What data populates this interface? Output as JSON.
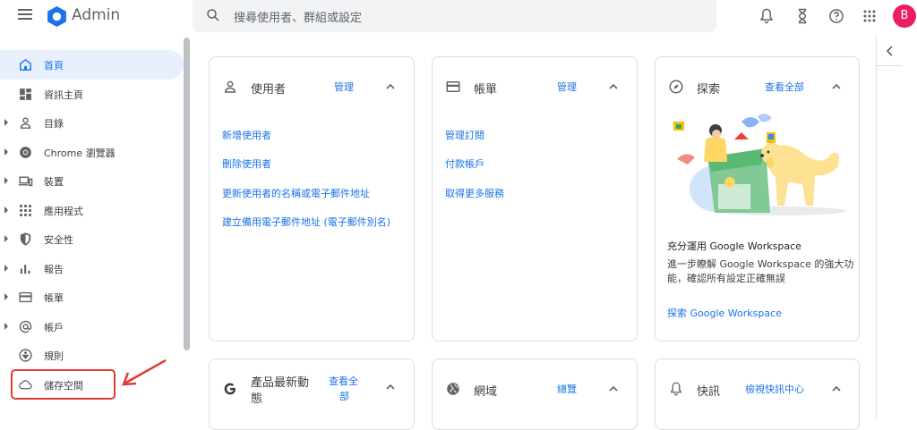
{
  "app": {
    "name": "Admin",
    "avatar_letter": "B"
  },
  "search": {
    "placeholder": "搜尋使用者、群組或設定"
  },
  "sidebar": {
    "items": [
      {
        "label": "首頁",
        "icon": "home-icon",
        "active": true,
        "expandable": false
      },
      {
        "label": "資訊主頁",
        "icon": "dashboard-icon",
        "active": false,
        "expandable": false
      },
      {
        "label": "目錄",
        "icon": "person-icon",
        "active": false,
        "expandable": true
      },
      {
        "label": "Chrome 瀏覽器",
        "icon": "chrome-icon",
        "active": false,
        "expandable": true
      },
      {
        "label": "裝置",
        "icon": "devices-icon",
        "active": false,
        "expandable": true
      },
      {
        "label": "應用程式",
        "icon": "apps-grid-icon",
        "active": false,
        "expandable": true
      },
      {
        "label": "安全性",
        "icon": "shield-icon",
        "active": false,
        "expandable": true
      },
      {
        "label": "報告",
        "icon": "bar-chart-icon",
        "active": false,
        "expandable": true
      },
      {
        "label": "帳單",
        "icon": "credit-card-icon",
        "active": false,
        "expandable": true
      },
      {
        "label": "帳戶",
        "icon": "at-sign-icon",
        "active": false,
        "expandable": true
      },
      {
        "label": "規則",
        "icon": "rules-icon",
        "active": false,
        "expandable": false
      },
      {
        "label": "儲存空間",
        "icon": "cloud-icon",
        "active": false,
        "expandable": false
      }
    ]
  },
  "cards": {
    "users": {
      "title": "使用者",
      "action": "管理",
      "links": [
        "新增使用者",
        "刪除使用者",
        "更新使用者的名稱或電子郵件地址",
        "建立備用電子郵件地址 (電子郵件別名)"
      ]
    },
    "billing": {
      "title": "帳單",
      "action": "管理",
      "links": [
        "管理訂閱",
        "付款帳戶",
        "取得更多服務"
      ]
    },
    "explore": {
      "title": "探索",
      "action": "查看全部",
      "promo_title": "充分運用 Google Workspace",
      "promo_desc": "進一步瞭解 Google Workspace 的強大功能，確認所有設定正確無誤",
      "promo_link": "探索 Google Workspace"
    },
    "product_updates": {
      "title_line1": "產品最新動",
      "title_line2": "態",
      "action_line1": "查看全",
      "action_line2": "部"
    },
    "domains": {
      "title": "網域",
      "action": "總覽"
    },
    "alerts": {
      "title": "快訊",
      "action": "檢視快訊中心"
    }
  },
  "colors": {
    "accent": "#1a73e8",
    "active_bg": "#e8f0fe",
    "highlight": "#e53935",
    "avatar": "#e91e63"
  }
}
